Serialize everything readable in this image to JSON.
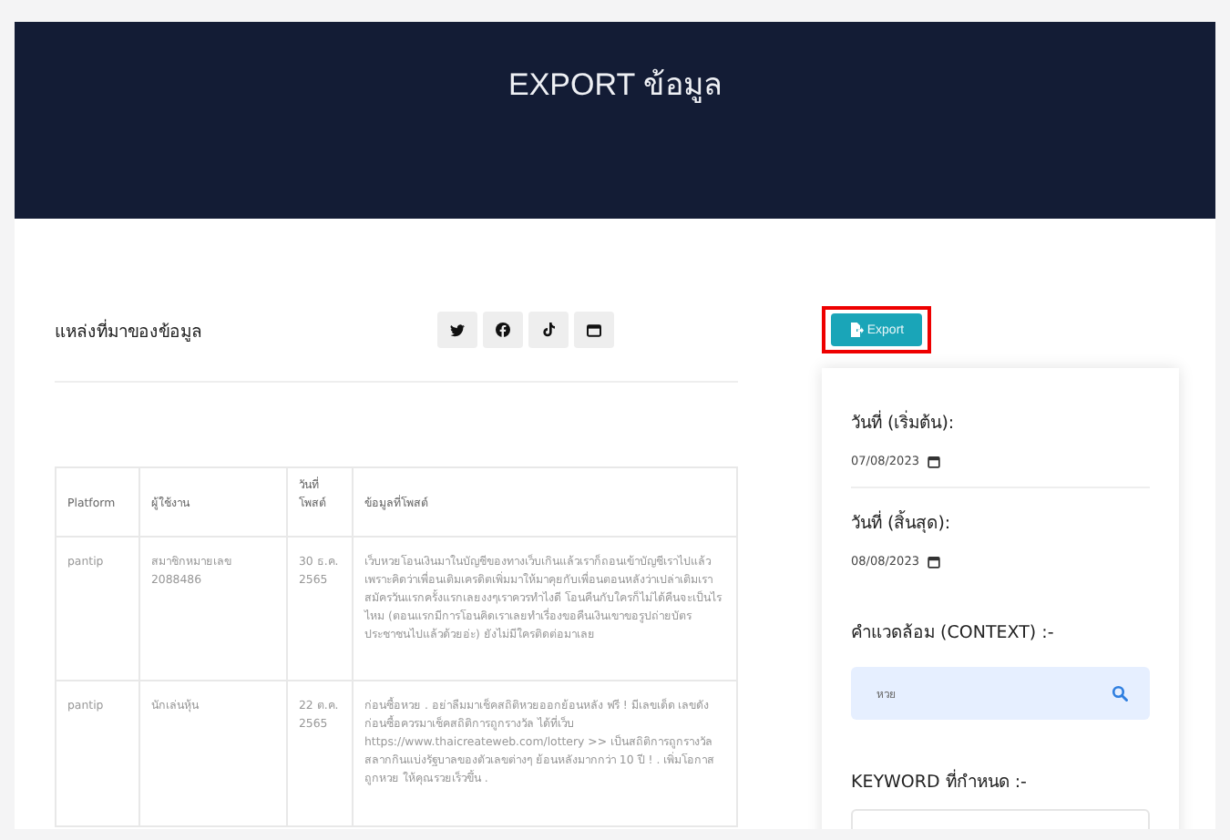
{
  "header": {
    "title": "EXPORT ข้อมูล"
  },
  "source": {
    "title": "แหล่งที่มาของข้อมูล",
    "platforms": [
      {
        "kind": "twitter"
      },
      {
        "kind": "facebook"
      },
      {
        "kind": "tiktok"
      },
      {
        "kind": "web"
      }
    ]
  },
  "table": {
    "columns": [
      "Platform",
      "ผู้ใช้งาน",
      "วันที่ โพสต์",
      "ข้อมูลที่โพสต์"
    ],
    "rows": [
      {
        "cells": [
          "pantip",
          "สมาชิกหมายเลข 2088486",
          "30 ธ.ค. 2565",
          "เว็บหวยโอนเงินมาในบัญชีของทางเว็บเกินแล้วเราก็ถอนเข้าบัญชีเราไปแล้วเพราะคิดว่าเพื่อนเติมเครดิตเพิ่มมาให้มาคุยกับเพื่อนตอนหลังว่าเปล่าเติมเราสมัครวันแรกครั้งแรกเลยงงๆเราควรทำไงดี โอนคืนกับใครก็ไม่ได้คืนจะเป็นไรไหม (ตอนแรกมีการโอนคิดเราเลยทำเรื่องขอคืนเงินเขาขอรูปถ่ายบัตรประชาชนไปแล้วด้วยอ่ะ) ยังไม่มีใครติดต่อมาเลย"
        ]
      },
      {
        "cells": [
          "pantip",
          "นักเล่นหุ้น",
          "22 ต.ค. 2565",
          "ก่อนซื้อหวย . อย่าลืมมาเช็คสถิติหวยออกย้อนหลัง ฟรี ! มีเลขเด็ด เลขดัง ก่อนซื้อควรมาเช็คสถิติการถูกรางวัล ได้ที่เว็บ https://www.thaicreateweb.com/lottery >> เป็นสถิติการถูกรางวัลสลากกินแบ่งรัฐบาลของตัวเลขต่างๆ ย้อนหลังมากกว่า 10 ปี ! . เพิ่มโอกาสถูกหวย ให้คุณรวยเร็วขึ้น ."
        ]
      }
    ]
  },
  "export_button": {
    "label": "Export",
    "highlighted": true
  },
  "filters": {
    "start_label": "วันที่ (เริ่มต้น):",
    "start_date": "07/08/2023",
    "end_label": "วันที่ (สิ้นสุด):",
    "end_date": "08/08/2023",
    "context_label": "คำแวดล้อม (CONTEXT) :-",
    "context_value": "หวย",
    "keyword_label": "KEYWORD ที่กำหนด :-"
  }
}
